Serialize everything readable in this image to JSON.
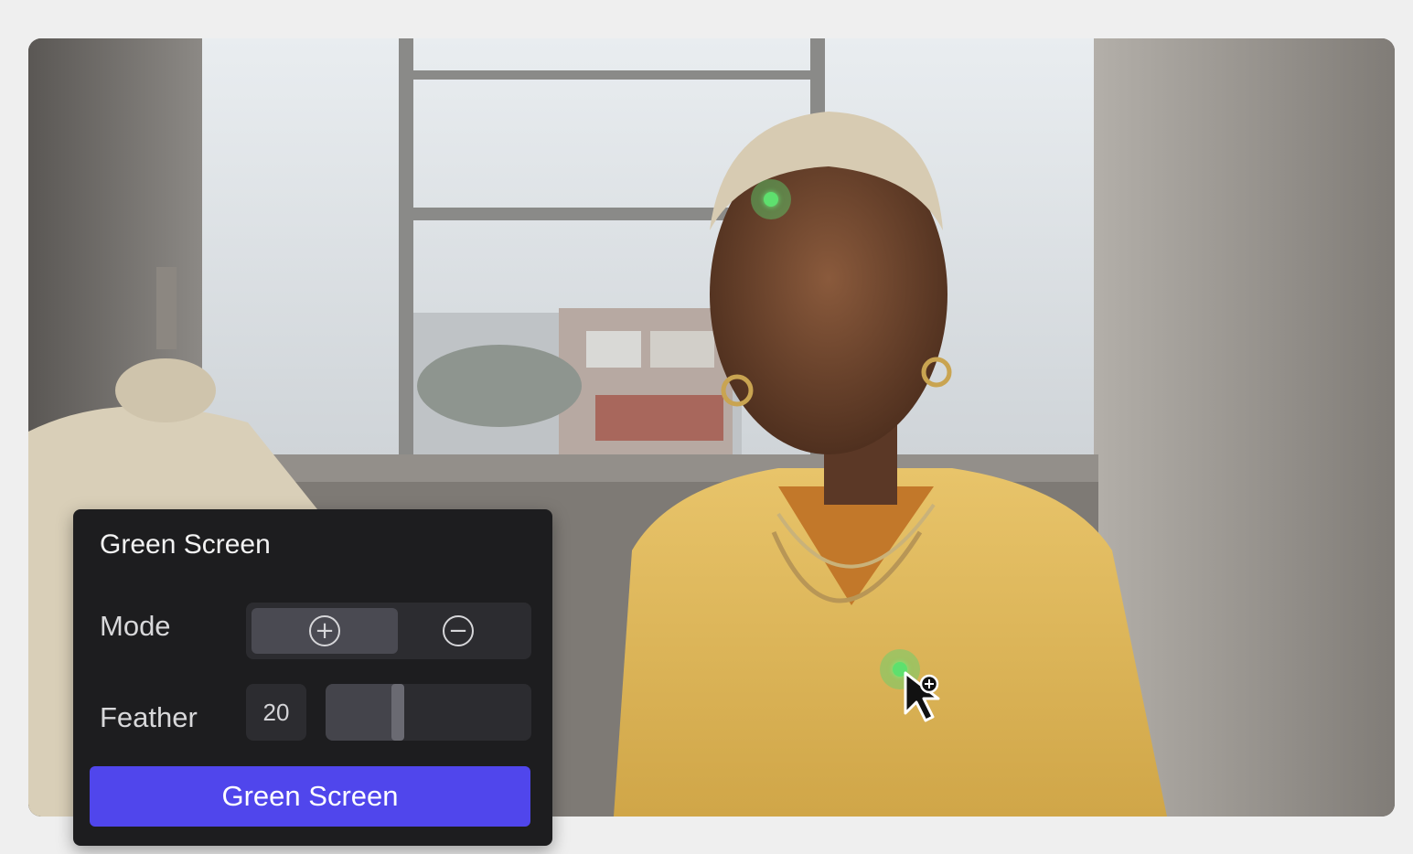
{
  "panel": {
    "title": "Green Screen",
    "mode_label": "Mode",
    "mode_options": [
      {
        "icon": "plus-circle-icon",
        "glyph": "+",
        "active": true
      },
      {
        "icon": "minus-circle-icon",
        "glyph": "−",
        "active": false
      }
    ],
    "feather_label": "Feather",
    "feather_value": "20",
    "feather_fraction": 0.35,
    "apply_button": "Green Screen"
  },
  "scene": {
    "accent_color": "#5046ec",
    "tracking_color": "#5ee06e",
    "cursor": "pointer-add-icon"
  }
}
